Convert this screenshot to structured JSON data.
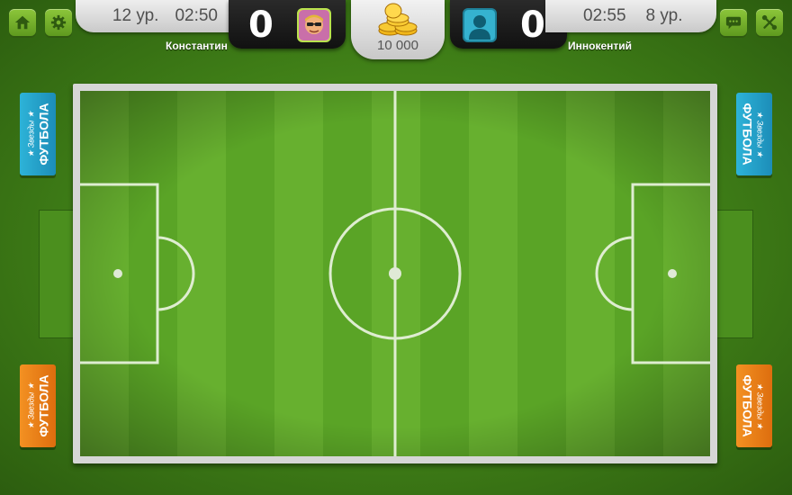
{
  "top_left_buttons": [
    {
      "name": "home",
      "icon": "home-icon"
    },
    {
      "name": "settings",
      "icon": "gear-icon"
    }
  ],
  "top_right_buttons": [
    {
      "name": "chat",
      "icon": "chat-icon"
    },
    {
      "name": "tools",
      "icon": "tools-icon"
    }
  ],
  "player_left": {
    "level": "12 ур.",
    "timer": "02:50",
    "score": "0",
    "name": "Константин",
    "avatar_icon": "player-photo-avatar"
  },
  "player_right": {
    "level": "8 ур.",
    "timer": "02:55",
    "score": "0",
    "name": "Иннокентий",
    "avatar_icon": "default-user-avatar"
  },
  "coins": {
    "amount": "10 000",
    "icon": "gold-coins-icon"
  },
  "banners": {
    "line1": "★ Звезды ★",
    "line2": "ФУТБОЛА",
    "colors": {
      "blue": "#2aaed6",
      "orange": "#ef8a1c"
    }
  },
  "colors": {
    "pitch_light": "#62ac2c",
    "pitch_dark": "#559e24",
    "lines": "#e8f3dc",
    "button_green": "#7cb731",
    "hud_dark": "#1b1b1b"
  }
}
